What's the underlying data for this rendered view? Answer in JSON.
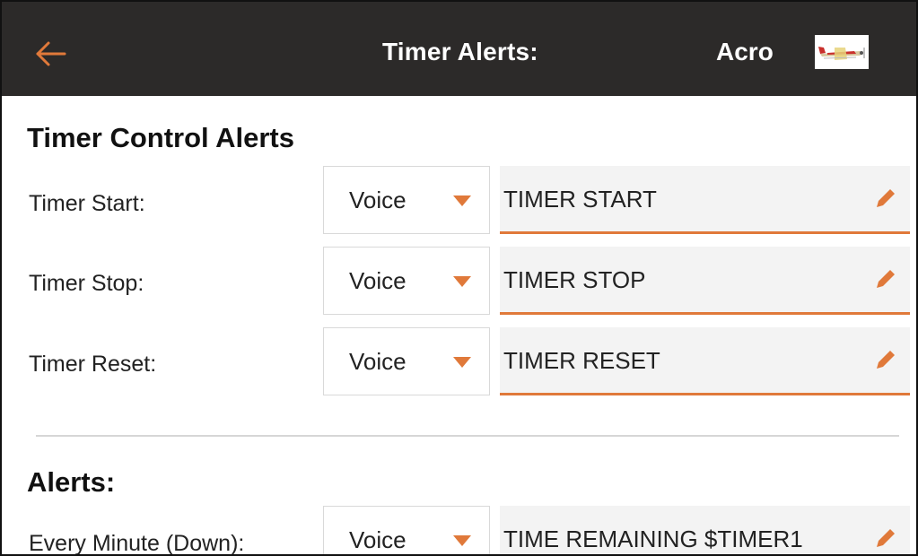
{
  "header": {
    "back_icon": "arrow-left-icon",
    "title": "Timer Alerts:",
    "model_name": "Acro",
    "model_image_icon": "airplane-thumbnail-icon",
    "accent_color": "#e0793a"
  },
  "timer_control": {
    "title": "Timer Control Alerts",
    "rows": [
      {
        "label": "Timer Start:",
        "type": "Voice",
        "text": "TIMER START"
      },
      {
        "label": "Timer Stop:",
        "type": "Voice",
        "text": "TIMER STOP"
      },
      {
        "label": "Timer Reset:",
        "type": "Voice",
        "text": "TIMER RESET"
      }
    ]
  },
  "alerts": {
    "title": "Alerts:",
    "rows": [
      {
        "label": "Every Minute (Down):",
        "type": "Voice",
        "text": "TIME REMAINING $TIMER1"
      }
    ]
  }
}
